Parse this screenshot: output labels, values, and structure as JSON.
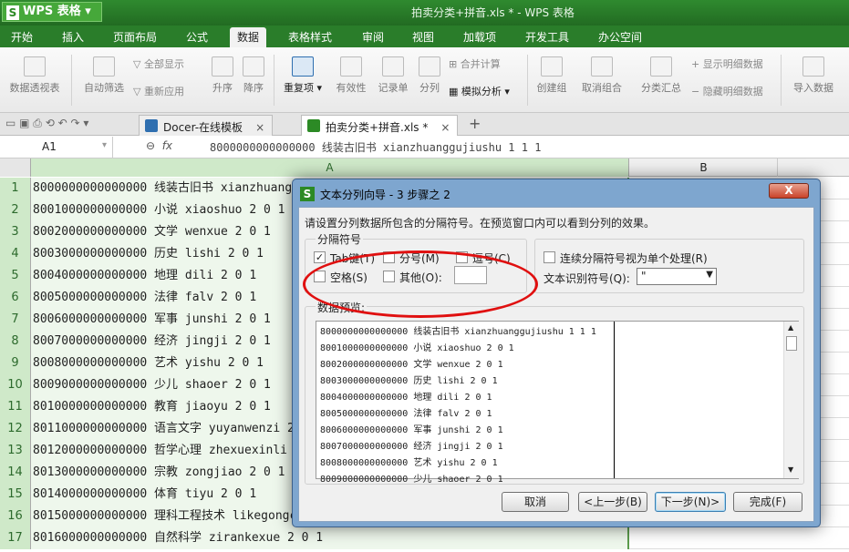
{
  "app": {
    "logo_text": "WPS 表格",
    "doc_title": "拍卖分类+拼音.xls * - WPS 表格"
  },
  "menu": [
    "开始",
    "插入",
    "页面布局",
    "公式",
    "数据",
    "表格样式",
    "审阅",
    "视图",
    "加载项",
    "开发工具",
    "办公空间"
  ],
  "ribbon": {
    "pivot": "数据透视表",
    "autofilter": "自动筛选",
    "show_all": "全部显示",
    "reapply": "重新应用",
    "sort_asc": "升序",
    "sort_desc": "降序",
    "duplicates": "重复项",
    "validity": "有效性",
    "record": "记录单",
    "split": "分列",
    "consolidate": "合并计算",
    "whatif": "模拟分析",
    "create_group": "创建组",
    "ungroup": "取消组合",
    "subtotal": "分类汇总",
    "show_detail": "显示明细数据",
    "hide_detail": "隐藏明细数据",
    "import": "导入数据"
  },
  "tabs": [
    {
      "label": "Docer-在线模板",
      "close": "×"
    },
    {
      "label": "拍卖分类+拼音.xls *",
      "close": "×"
    }
  ],
  "new_tab": "+",
  "formula_bar": {
    "name_box": "A1",
    "fx": "fx",
    "content": "8000000000000000 线装古旧书 xianzhuanggujiushu 1 1 1"
  },
  "columns": [
    "A",
    "B"
  ],
  "rows": [
    {
      "n": "1",
      "a": "8000000000000000 线装古旧书 xianzhuanggujiushu 1 1 1"
    },
    {
      "n": "2",
      "a": "8001000000000000 小说 xiaoshuo 2 0 1"
    },
    {
      "n": "3",
      "a": "8002000000000000 文学 wenxue 2 0 1"
    },
    {
      "n": "4",
      "a": "8003000000000000 历史 lishi 2 0 1"
    },
    {
      "n": "5",
      "a": "8004000000000000 地理 dili 2 0 1"
    },
    {
      "n": "6",
      "a": "8005000000000000 法律 falv 2 0 1"
    },
    {
      "n": "7",
      "a": "8006000000000000 军事 junshi 2 0 1"
    },
    {
      "n": "8",
      "a": "8007000000000000 经济 jingji 2 0 1"
    },
    {
      "n": "9",
      "a": "8008000000000000 艺术 yishu 2 0 1"
    },
    {
      "n": "10",
      "a": "8009000000000000 少儿 shaoer 2 0 1"
    },
    {
      "n": "11",
      "a": "8010000000000000 教育 jiaoyu 2 0 1"
    },
    {
      "n": "12",
      "a": "8011000000000000 语言文字 yuyanwenzi 2 0 1"
    },
    {
      "n": "13",
      "a": "8012000000000000 哲学心理 zhexuexinli 2 0 1"
    },
    {
      "n": "14",
      "a": "8013000000000000 宗教 zongjiao 2 0 1"
    },
    {
      "n": "15",
      "a": "8014000000000000 体育 tiyu 2 0 1"
    },
    {
      "n": "16",
      "a": "8015000000000000 理科工程技术 likegongchengjishu 2 0 1"
    },
    {
      "n": "17",
      "a": "8016000000000000 自然科学 zirankexue 2 0 1"
    }
  ],
  "dialog": {
    "title": "文本分列向导 - 3 步骤之 2",
    "close": "X",
    "instruction": "请设置分列数据所包含的分隔符号。在预览窗口内可以看到分列的效果。",
    "delim_group": "分隔符号",
    "tab": "Tab键(T)",
    "tab_checked": true,
    "semicolon": "分号(M)",
    "comma": "逗号(C)",
    "space": "空格(S)",
    "other": "其他(O):",
    "other_value": "",
    "consecutive": "连续分隔符号视为单个处理(R)",
    "qualifier_label": "文本识别符号(Q):",
    "qualifier_value": "\"",
    "preview_label": "数据预览:",
    "preview_lines": [
      "8000000000000000 线装古旧书 xianzhuanggujiushu 1 1 1",
      "8001000000000000 小说 xiaoshuo 2 0 1",
      "8002000000000000 文学 wenxue 2 0 1",
      "8003000000000000 历史 lishi 2 0 1",
      "8004000000000000 地理 dili 2 0 1",
      "8005000000000000 法律 falv 2 0 1",
      "8006000000000000 军事 junshi 2 0 1",
      "8007000000000000 经济 jingji 2 0 1",
      "8008000000000000 艺术 yishu 2 0 1",
      "8009000000000000 少儿 shaoer 2 0 1"
    ],
    "cancel": "取消",
    "prev": "<上一步(B)",
    "next": "下一步(N)>",
    "finish": "完成(F)"
  },
  "colors": {
    "accent": "#2a7d2a",
    "highlight_ellipse": "#e01010"
  }
}
